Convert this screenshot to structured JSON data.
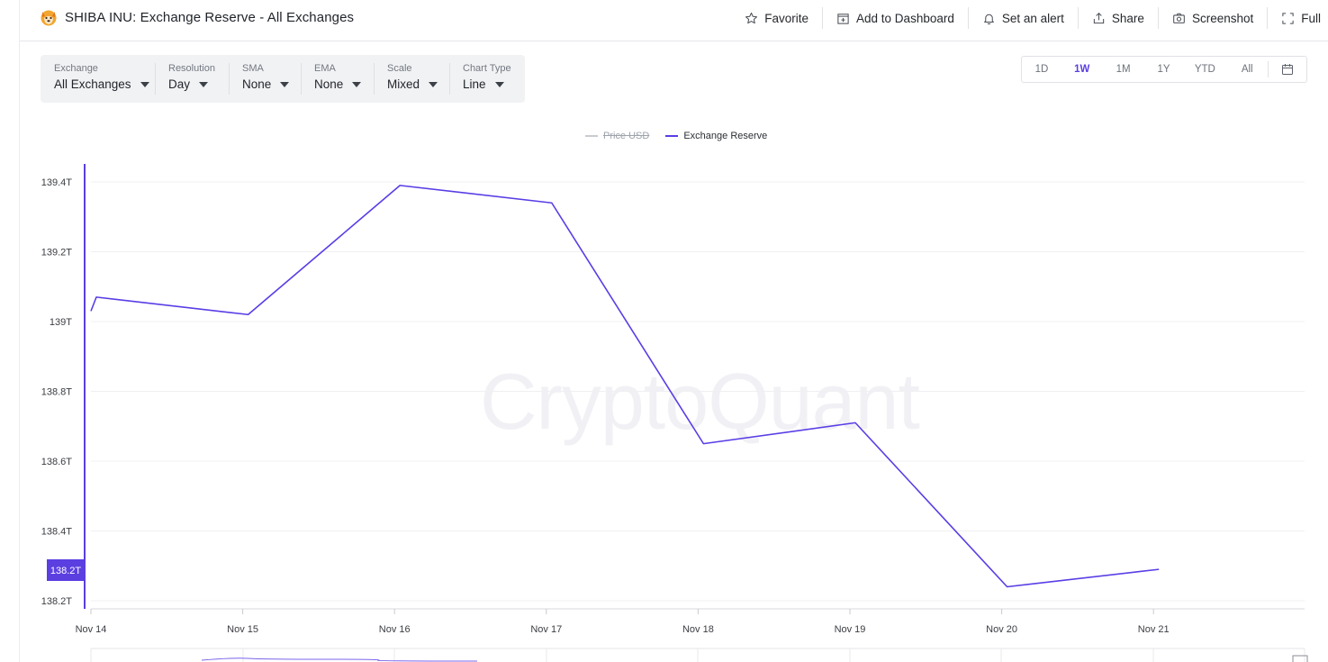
{
  "header": {
    "title": "SHIBA INU: Exchange Reserve - All Exchanges",
    "actions": [
      {
        "label": "Favorite",
        "icon": "star-icon"
      },
      {
        "label": "Add to Dashboard",
        "icon": "add-dashboard-icon"
      },
      {
        "label": "Set an alert",
        "icon": "bell-icon"
      },
      {
        "label": "Share",
        "icon": "share-icon"
      },
      {
        "label": "Screenshot",
        "icon": "camera-icon"
      },
      {
        "label": "Full",
        "icon": "fullscreen-icon"
      }
    ]
  },
  "filters": [
    {
      "label": "Exchange",
      "value": "All Exchanges"
    },
    {
      "label": "Resolution",
      "value": "Day"
    },
    {
      "label": "SMA",
      "value": "None"
    },
    {
      "label": "EMA",
      "value": "None"
    },
    {
      "label": "Scale",
      "value": "Mixed"
    },
    {
      "label": "Chart Type",
      "value": "Line"
    }
  ],
  "range_options": [
    "1D",
    "1W",
    "1M",
    "1Y",
    "YTD",
    "All"
  ],
  "range_selected": "1W",
  "watermark": "CryptoQuant",
  "colors": {
    "accent": "#5b3fe0",
    "series_line": "#5a3de6",
    "grid": "#f0f0f3",
    "axis_text": "#3a3d42"
  },
  "chart_data": {
    "type": "line",
    "legend": [
      {
        "name": "Price USD",
        "visible": false,
        "color": "#c8cbd0"
      },
      {
        "name": "Exchange Reserve",
        "visible": true,
        "color": "#5a3de6"
      }
    ],
    "x": [
      "Nov 14",
      "Nov 15",
      "Nov 16",
      "Nov 17",
      "Nov 18",
      "Nov 19",
      "Nov 20",
      "Nov 21"
    ],
    "series": [
      {
        "name": "Exchange Reserve",
        "values": [
          139.07,
          139.02,
          139.39,
          139.34,
          138.65,
          138.71,
          138.24,
          138.29
        ],
        "leading_value": 139.03
      }
    ],
    "y_ticks": [
      "139.4T",
      "139.2T",
      "139T",
      "138.8T",
      "138.6T",
      "138.4T",
      "138.2T"
    ],
    "y_tick_values": [
      139.4,
      139.2,
      139.0,
      138.8,
      138.6,
      138.4,
      138.2
    ],
    "ylim": [
      138.2,
      139.4
    ],
    "y_unit": "T",
    "y_marker_label": "138.2T",
    "grid": true,
    "legend_placement": "top-center"
  }
}
